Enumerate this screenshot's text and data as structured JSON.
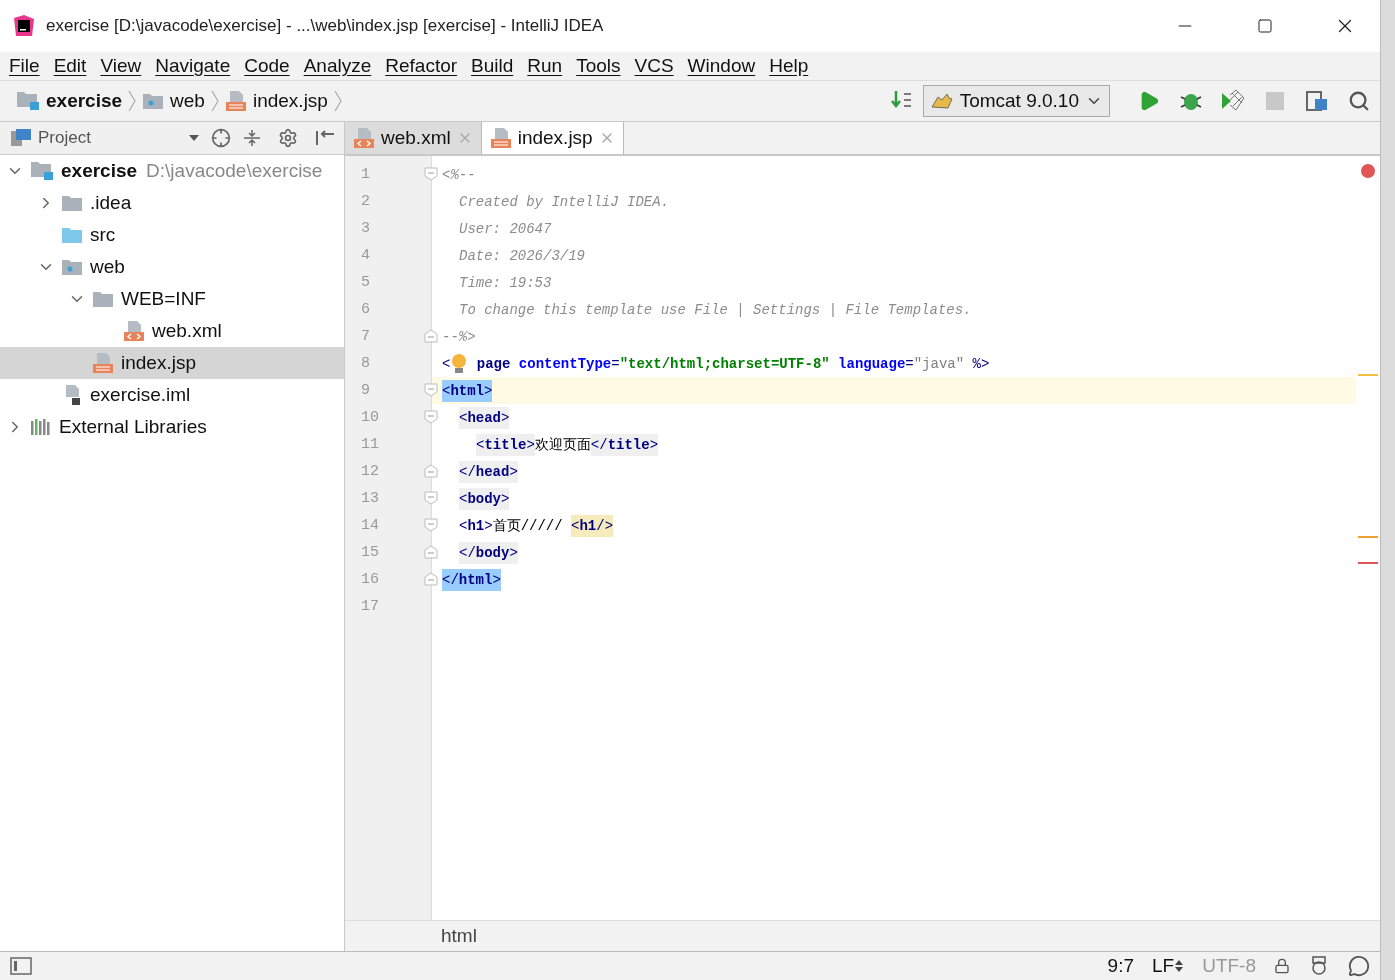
{
  "window": {
    "title": "exercise [D:\\javacode\\exercise] - ...\\web\\index.jsp [exercise] - IntelliJ IDEA"
  },
  "menu": [
    "File",
    "Edit",
    "View",
    "Navigate",
    "Code",
    "Analyze",
    "Refactor",
    "Build",
    "Run",
    "Tools",
    "VCS",
    "Window",
    "Help"
  ],
  "breadcrumbs": [
    {
      "label": "exercise",
      "kind": "project"
    },
    {
      "label": "web",
      "kind": "webfolder"
    },
    {
      "label": "index.jsp",
      "kind": "jsp"
    }
  ],
  "run_config": {
    "label": "Tomcat 9.0.10"
  },
  "project_panel": {
    "title": "Project",
    "tree": [
      {
        "label": "exercise",
        "detail": "D:\\javacode\\exercise",
        "kind": "project",
        "expanded": true,
        "selected": false,
        "children": [
          {
            "label": ".idea",
            "kind": "folder",
            "expanded": false,
            "selected": false
          },
          {
            "label": "src",
            "kind": "source",
            "selected": false
          },
          {
            "label": "web",
            "kind": "webfolder",
            "expanded": true,
            "selected": false,
            "children": [
              {
                "label": "WEB=INF",
                "kind": "folder",
                "expanded": true,
                "selected": false,
                "children": [
                  {
                    "label": "web.xml",
                    "kind": "xml",
                    "selected": false
                  }
                ]
              },
              {
                "label": "index.jsp",
                "kind": "jsp",
                "selected": true
              }
            ]
          },
          {
            "label": "exercise.iml",
            "kind": "iml",
            "selected": false
          }
        ]
      },
      {
        "label": "External Libraries",
        "kind": "libraries",
        "expanded": false,
        "selected": false
      }
    ]
  },
  "editor": {
    "tabs": [
      {
        "label": "web.xml",
        "kind": "xml",
        "selected": false
      },
      {
        "label": "index.jsp",
        "kind": "jsp",
        "selected": true
      }
    ],
    "lines": [
      {
        "number": "1",
        "current": false,
        "fold_start": true,
        "fold_end": false,
        "segments": [
          {
            "kind": "plain",
            "tokens": [
              {
                "kind": "comment",
                "text": "<%--"
              }
            ]
          }
        ],
        "children": [
          {
            "number": "2",
            "current": false,
            "fold_start": false,
            "fold_end": false,
            "segments": [
              {
                "kind": "plain",
                "tokens": [
                  {
                    "kind": "comment",
                    "text": "Created by IntelliJ IDEA."
                  }
                ]
              }
            ]
          },
          {
            "number": "3",
            "current": false,
            "fold_start": false,
            "fold_end": false,
            "segments": [
              {
                "kind": "plain",
                "tokens": [
                  {
                    "kind": "comment",
                    "text": "User: 20647"
                  }
                ]
              }
            ]
          },
          {
            "number": "4",
            "current": false,
            "fold_start": false,
            "fold_end": false,
            "segments": [
              {
                "kind": "plain",
                "tokens": [
                  {
                    "kind": "comment",
                    "text": "Date: 2026/3/19"
                  }
                ]
              }
            ]
          },
          {
            "number": "5",
            "current": false,
            "fold_start": false,
            "fold_end": false,
            "segments": [
              {
                "kind": "plain",
                "tokens": [
                  {
                    "kind": "comment",
                    "text": "Time: 19:53"
                  }
                ]
              }
            ]
          },
          {
            "number": "6",
            "current": false,
            "fold_start": false,
            "fold_end": false,
            "segments": [
              {
                "kind": "plain",
                "tokens": [
                  {
                    "kind": "comment",
                    "text": "To change this template use File | Settings | File Templates."
                  }
                ]
              }
            ]
          }
        ]
      },
      {
        "number": "7",
        "current": false,
        "fold_start": false,
        "fold_end": true,
        "segments": [
          {
            "kind": "plain",
            "tokens": [
              {
                "kind": "comment",
                "text": "--%>"
              }
            ]
          }
        ]
      },
      {
        "number": "8",
        "current": false,
        "fold_start": false,
        "fold_end": false,
        "segments": [
          {
            "kind": "plain",
            "tokens": [
              {
                "kind": "punct",
                "text": "<"
              }
            ]
          },
          {
            "kind": "bulb"
          },
          {
            "kind": "plain",
            "tokens": [
              {
                "kind": "tag",
                "text": " page "
              },
              {
                "kind": "attr",
                "text": "contentType"
              },
              {
                "kind": "punct",
                "text": "="
              },
              {
                "kind": "string",
                "text": "\"text/html;charset=UTF-8\" "
              },
              {
                "kind": "attr",
                "text": "language"
              },
              {
                "kind": "punct",
                "text": "="
              },
              {
                "kind": "value",
                "text": "\"java\" "
              },
              {
                "kind": "punct",
                "text": "%>"
              }
            ]
          }
        ]
      },
      {
        "number": "9",
        "current": true,
        "fold_start": true,
        "fold_end": false,
        "segments": [
          {
            "kind": "match",
            "tokens": [
              {
                "kind": "punct",
                "text": "<"
              },
              {
                "kind": "tag",
                "text": "html"
              },
              {
                "kind": "punct",
                "text": ">"
              }
            ]
          }
        ],
        "children": [
          {
            "number": "10",
            "current": false,
            "fold_start": true,
            "fold_end": false,
            "segments": [
              {
                "kind": "scope",
                "tokens": [
                  {
                    "kind": "punct",
                    "text": "<"
                  },
                  {
                    "kind": "tag",
                    "text": "head"
                  },
                  {
                    "kind": "punct",
                    "text": ">"
                  }
                ]
              }
            ],
            "children": [
              {
                "number": "11",
                "current": false,
                "fold_start": false,
                "fold_end": false,
                "segments": [
                  {
                    "kind": "scope",
                    "tokens": [
                      {
                        "kind": "punct",
                        "text": "<"
                      },
                      {
                        "kind": "tag",
                        "text": "title"
                      },
                      {
                        "kind": "punct",
                        "text": ">"
                      }
                    ]
                  },
                  {
                    "kind": "plain",
                    "tokens": [
                      {
                        "kind": "text",
                        "text": "欢迎页面"
                      }
                    ]
                  },
                  {
                    "kind": "scope",
                    "tokens": [
                      {
                        "kind": "punct",
                        "text": "</"
                      },
                      {
                        "kind": "tag",
                        "text": "title"
                      },
                      {
                        "kind": "punct",
                        "text": ">"
                      }
                    ]
                  }
                ]
              }
            ]
          },
          {
            "number": "12",
            "current": false,
            "fold_start": false,
            "fold_end": true,
            "segments": [
              {
                "kind": "scope",
                "tokens": [
                  {
                    "kind": "punct",
                    "text": "</"
                  },
                  {
                    "kind": "tag",
                    "text": "head"
                  },
                  {
                    "kind": "punct",
                    "text": ">"
                  }
                ]
              }
            ]
          },
          {
            "number": "13",
            "current": false,
            "fold_start": true,
            "fold_end": false,
            "segments": [
              {
                "kind": "scope",
                "tokens": [
                  {
                    "kind": "punct",
                    "text": "<"
                  },
                  {
                    "kind": "tag",
                    "text": "body"
                  },
                  {
                    "kind": "punct",
                    "text": ">"
                  }
                ]
              }
            ]
          },
          {
            "number": "14",
            "current": false,
            "fold_start": true,
            "fold_end": false,
            "segments": [
              {
                "kind": "plain",
                "tokens": [
                  {
                    "kind": "punct",
                    "text": "<"
                  },
                  {
                    "kind": "tag",
                    "text": "h1"
                  },
                  {
                    "kind": "punct",
                    "text": ">"
                  },
                  {
                    "kind": "text",
                    "text": "首页///// "
                  }
                ]
              },
              {
                "kind": "warn",
                "tokens": [
                  {
                    "kind": "punct",
                    "text": "<"
                  },
                  {
                    "kind": "tag",
                    "text": "h1"
                  },
                  {
                    "kind": "punct",
                    "text": "/>"
                  }
                ]
              }
            ]
          },
          {
            "number": "15",
            "current": false,
            "fold_start": false,
            "fold_end": true,
            "segments": [
              {
                "kind": "scope",
                "tokens": [
                  {
                    "kind": "punct",
                    "text": "</"
                  },
                  {
                    "kind": "tag",
                    "text": "body"
                  },
                  {
                    "kind": "punct",
                    "text": ">"
                  }
                ]
              }
            ]
          }
        ]
      },
      {
        "number": "16",
        "current": false,
        "fold_start": false,
        "fold_end": true,
        "segments": [
          {
            "kind": "match",
            "tokens": [
              {
                "kind": "punct",
                "text": "</"
              },
              {
                "kind": "tag",
                "text": "html"
              },
              {
                "kind": "punct",
                "text": ">"
              }
            ]
          }
        ]
      },
      {
        "number": "17",
        "current": false,
        "fold_start": false,
        "fold_end": false
      }
    ],
    "breadcrumb": "html"
  },
  "status_bar": {
    "position": "9:7",
    "line_separator": "LF",
    "encoding": "UTF-8"
  }
}
